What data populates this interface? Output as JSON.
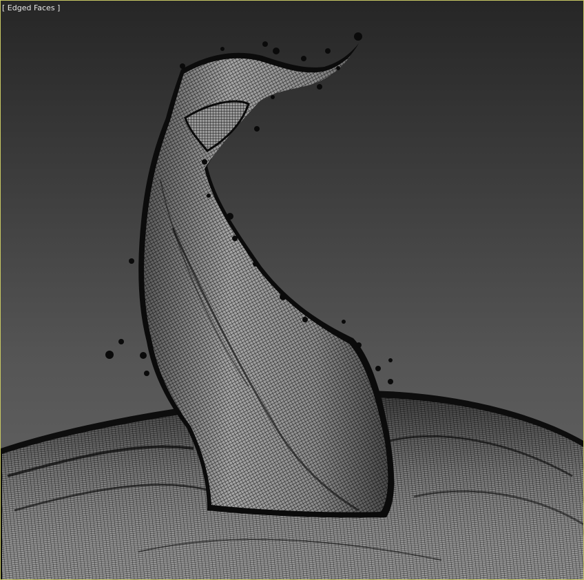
{
  "viewport": {
    "shading_mode_label": "[ Edged Faces ]",
    "border_color": "#c8c864",
    "mesh_edge_color": "#0a0a0a",
    "mesh_face_color": "#8c8c8c",
    "background_top_color": "#262626",
    "background_bottom_color": "#686868"
  }
}
